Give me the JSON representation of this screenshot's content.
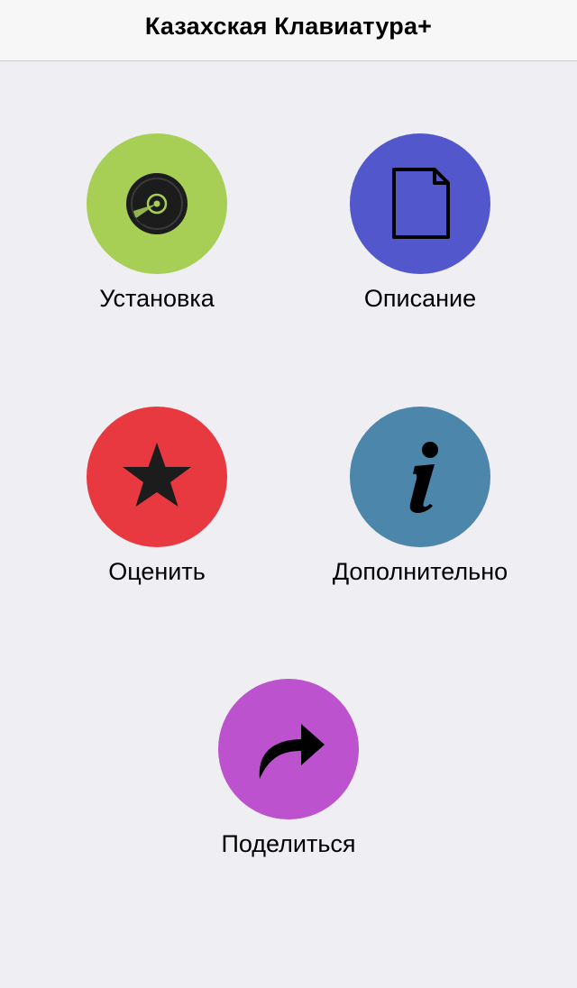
{
  "header": {
    "title": "Казахская Клавиатура+"
  },
  "menu": {
    "install": {
      "label": "Установка",
      "icon": "disc-icon",
      "color": "#a8cf55"
    },
    "description": {
      "label": "Описание",
      "icon": "document-icon",
      "color": "#5257cc"
    },
    "rate": {
      "label": "Оценить",
      "icon": "star-icon",
      "color": "#e7393f"
    },
    "more": {
      "label": "Дополнительно",
      "icon": "info-icon",
      "color": "#4c86aa"
    },
    "share": {
      "label": "Поделиться",
      "icon": "share-arrow-icon",
      "color": "#bd52ce"
    }
  }
}
